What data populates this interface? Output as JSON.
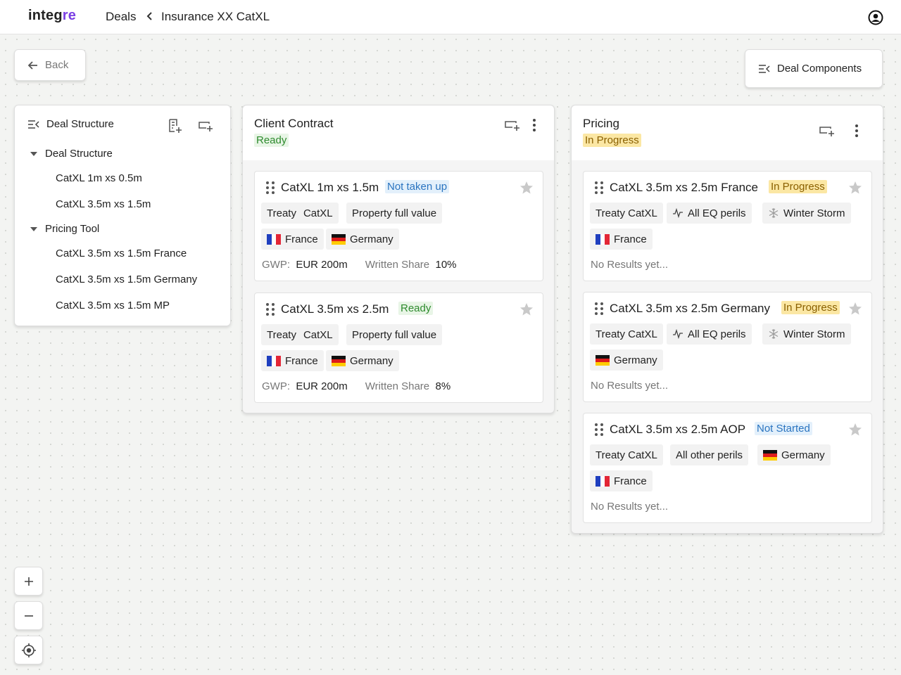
{
  "app": {
    "logo_main": "integ",
    "logo_accent": "re"
  },
  "breadcrumb": {
    "parent": "Deals",
    "current": "Insurance XX CatXL"
  },
  "toolbar": {
    "back_label": "Back",
    "components_label": "Deal Components"
  },
  "tree": {
    "title": "Deal Structure",
    "groups": [
      {
        "label": "Deal Structure",
        "items": [
          "CatXL 1m xs 0.5m",
          "CatXL 3.5m xs 1.5m"
        ]
      },
      {
        "label": "Pricing Tool",
        "items": [
          "CatXL 3.5m xs 1.5m France",
          "CatXL 3.5m xs 1.5m Germany",
          "CatXL 3.5m xs 1.5m MP"
        ]
      }
    ]
  },
  "contract": {
    "title": "Client Contract",
    "status": "Ready",
    "cards": [
      {
        "title": "CatXL 1m xs 1.5m",
        "badge": "Not taken up",
        "chip_type_a": "Treaty",
        "chip_type_b": "CatXL",
        "chip_basis": "Property full value",
        "country_1": "France",
        "country_2": "Germany",
        "gwp_label": "GWP:",
        "gwp_value": "EUR 200m",
        "share_label": "Written Share",
        "share_value": "10%"
      },
      {
        "title": "CatXL 3.5m xs 2.5m",
        "badge": "Ready",
        "chip_type_a": "Treaty",
        "chip_type_b": "CatXL",
        "chip_basis": "Property full value",
        "country_1": "France",
        "country_2": "Germany",
        "gwp_label": "GWP:",
        "gwp_value": "EUR 200m",
        "share_label": "Written Share",
        "share_value": "8%"
      }
    ]
  },
  "pricing": {
    "title": "Pricing",
    "status": "In Progress",
    "cards": [
      {
        "title": "CatXL 3.5m xs 2.5m France",
        "badge": "In Progress",
        "chip_type": "Treaty CatXL",
        "chip_peril": "All EQ perils",
        "chip_storm": "Winter Storm",
        "country": "France",
        "results": "No Results yet..."
      },
      {
        "title": "CatXL 3.5m xs 2.5m Germany",
        "badge": "In Progress",
        "chip_type": "Treaty CatXL",
        "chip_peril": "All EQ perils",
        "chip_storm": "Winter Storm",
        "country": "Germany",
        "results": "No Results yet..."
      },
      {
        "title": "CatXL 3.5m xs 2.5m AOP",
        "badge": "Not Started",
        "chip_type": "Treaty CatXL",
        "chip_peril": "All other perils",
        "country_1": "Germany",
        "country_2": "France",
        "results": "No Results yet..."
      }
    ]
  },
  "icons": [
    "arrow-left-icon",
    "chevron-left-icon",
    "user-icon",
    "menu-collapse-icon",
    "add-file-icon",
    "add-column-icon",
    "more-vertical-icon",
    "drag-handle-icon",
    "star-icon",
    "activity-icon",
    "snowflake-icon",
    "plus-icon",
    "minus-icon",
    "locate-icon"
  ],
  "colors": {
    "accent": "#7b3fe4",
    "ready": "#2e8b2e",
    "in_progress_bg": "#fbe7a4",
    "not_started": "#2a74c0"
  }
}
